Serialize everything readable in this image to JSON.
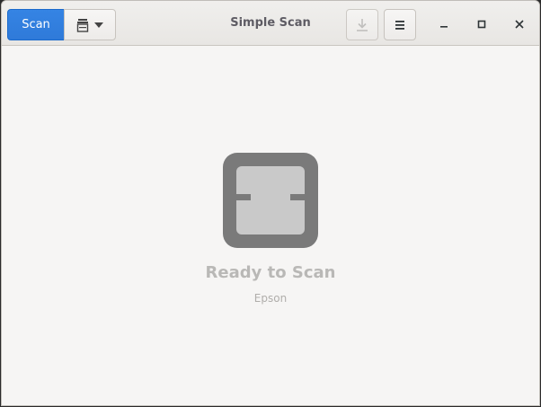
{
  "window": {
    "title": "Simple Scan"
  },
  "toolbar": {
    "scan_label": "Scan",
    "scan_type_icon": "document-scanner-icon",
    "dropdown_icon": "chevron-down-icon",
    "save_icon": "download-icon",
    "menu_icon": "hamburger-menu-icon"
  },
  "window_controls": {
    "minimize_icon": "minimize-icon",
    "maximize_icon": "maximize-icon",
    "close_icon": "close-icon"
  },
  "status": {
    "icon": "scanner-icon",
    "title": "Ready to Scan",
    "device": "Epson"
  },
  "colors": {
    "accent": "#3584e4",
    "background": "#f6f5f4",
    "status_icon": "#7a7a7a"
  }
}
